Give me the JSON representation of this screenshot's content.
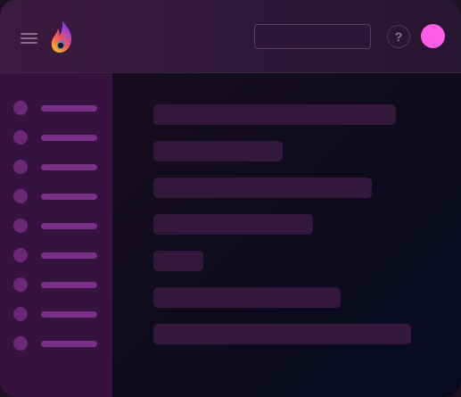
{
  "header": {
    "search": {
      "value": "",
      "placeholder": ""
    },
    "help_label": "?",
    "avatar_color": "#ff5ce8"
  },
  "theme": {
    "header_bg": "#3a1a40",
    "sidebar_bg": "#36123f",
    "nav_dot_color": "#6a2876",
    "nav_bar_color": "#7a2f88",
    "content_bar_color": "#34183b"
  },
  "sidebar": {
    "items": [
      {
        "icon": "placeholder-dot"
      },
      {
        "icon": "placeholder-dot"
      },
      {
        "icon": "placeholder-dot"
      },
      {
        "icon": "placeholder-dot"
      },
      {
        "icon": "placeholder-dot"
      },
      {
        "icon": "placeholder-dot"
      },
      {
        "icon": "placeholder-dot"
      },
      {
        "icon": "placeholder-dot"
      },
      {
        "icon": "placeholder-dot"
      }
    ]
  },
  "main": {
    "rows": [
      {
        "kind": "skeleton-line"
      },
      {
        "kind": "skeleton-line"
      },
      {
        "kind": "skeleton-line"
      },
      {
        "kind": "skeleton-line"
      },
      {
        "kind": "skeleton-line"
      },
      {
        "kind": "skeleton-line"
      },
      {
        "kind": "skeleton-line"
      }
    ]
  }
}
